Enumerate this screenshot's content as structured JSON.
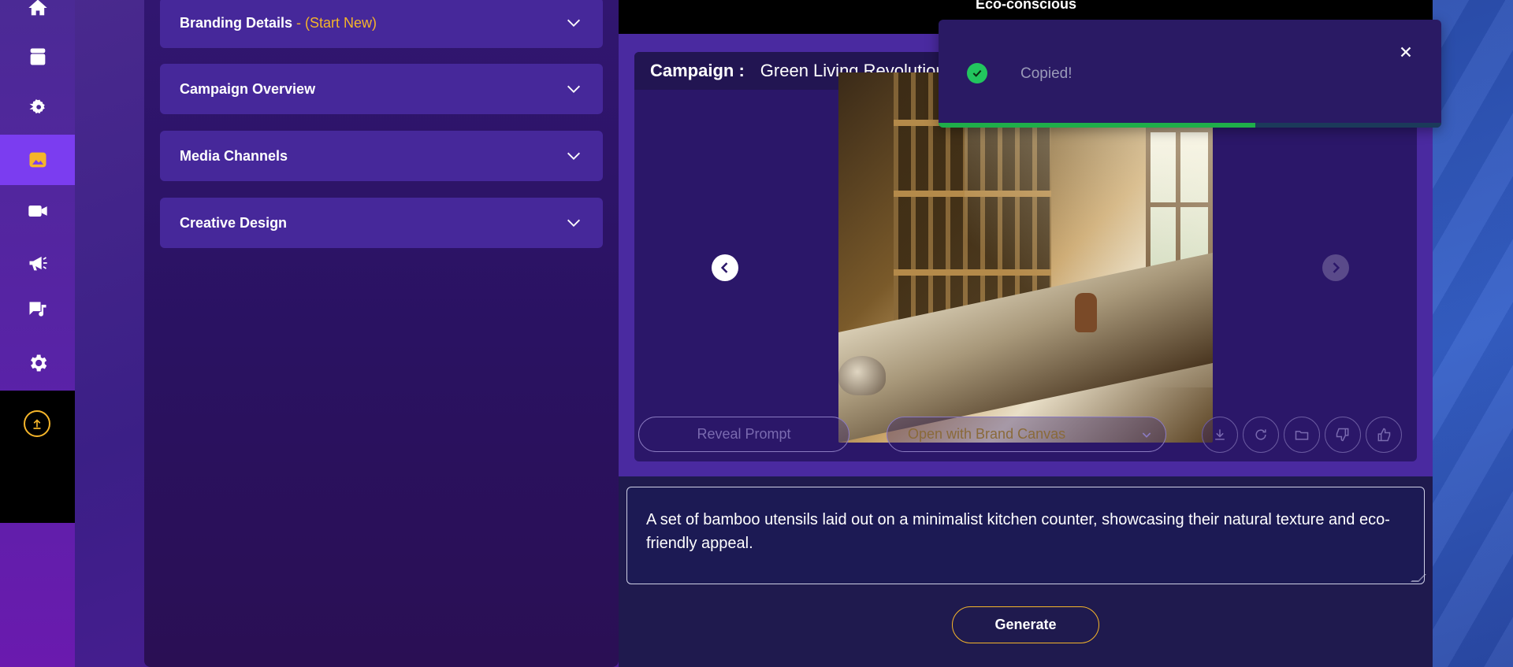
{
  "sidebar": {
    "items": [
      {
        "name": "home",
        "icon": "home-icon"
      },
      {
        "name": "archive",
        "icon": "archive-icon"
      },
      {
        "name": "workflow",
        "icon": "gear-arrow-icon"
      },
      {
        "name": "images",
        "icon": "image-icon",
        "active": true
      },
      {
        "name": "video",
        "icon": "video-icon"
      },
      {
        "name": "campaigns",
        "icon": "megaphone-icon"
      },
      {
        "name": "content",
        "icon": "chat-music-icon"
      },
      {
        "name": "settings",
        "icon": "gear-icon"
      }
    ],
    "upload_icon": "upload-icon"
  },
  "left_panel": {
    "accordions": [
      {
        "label": "Branding Details",
        "suffix": " - (Start New)"
      },
      {
        "label": "Campaign Overview",
        "suffix": ""
      },
      {
        "label": "Media Channels",
        "suffix": ""
      },
      {
        "label": "Creative Design",
        "suffix": ""
      }
    ]
  },
  "main": {
    "top_text": "Eco-conscious",
    "campaign_label": "Campaign :",
    "campaign_name": "Green Living Revolution",
    "reveal_prompt": "Reveal Prompt",
    "open_with": "Open with Brand Canvas",
    "prompt_text": "A set of bamboo utensils laid out on a minimalist kitchen counter, showcasing their natural texture and eco-friendly appeal.",
    "generate": "Generate"
  },
  "toast": {
    "message": "Copied!",
    "progress": 0.63
  },
  "colors": {
    "accent": "#f5b52a",
    "active_nav": "#7b3df0",
    "success": "#22c55e"
  }
}
